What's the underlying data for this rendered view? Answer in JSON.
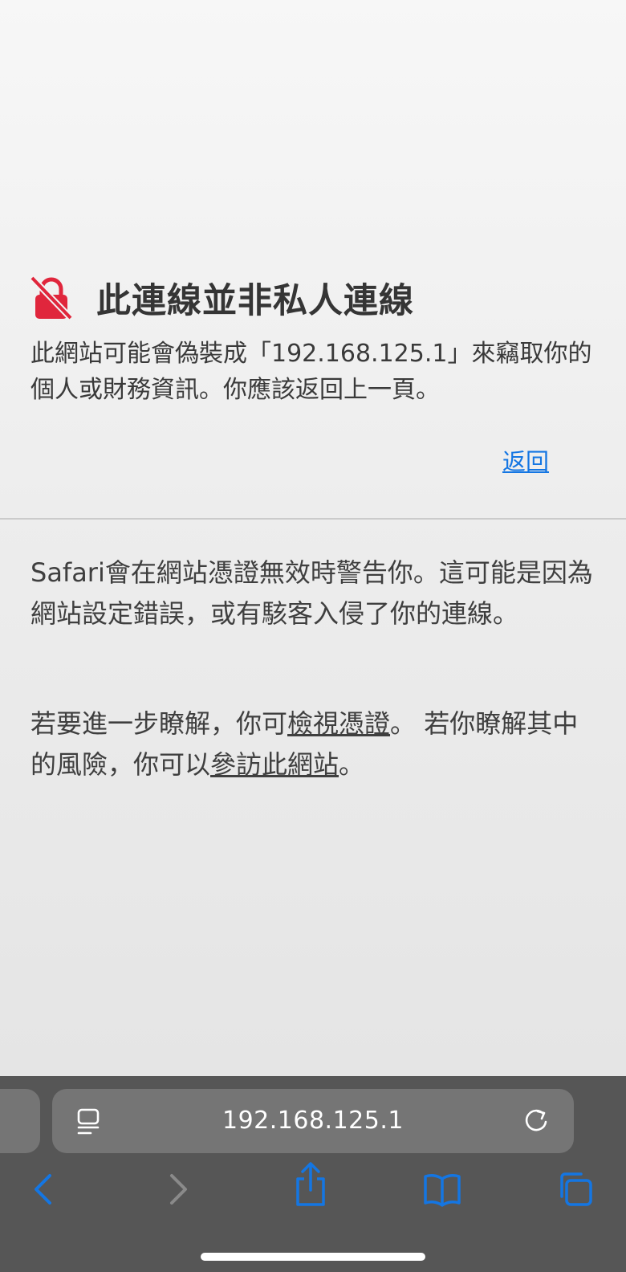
{
  "warning": {
    "title": "此連線並非私人連線",
    "body": "此網站可能會偽裝成「192.168.125.1」來竊取你的個人或財務資訊。你應該返回上一頁。",
    "back_link": "返回"
  },
  "info": {
    "paragraph": "Safari會在網站憑證無效時警告你。這可能是因為網站設定錯誤，或有駭客入侵了你的連線。",
    "more_prefix": "若要進一步瞭解，你可",
    "view_certificate_link": "檢視憑證",
    "more_middle": "。 若你瞭解其中的風險，你可以",
    "visit_site_link": "參訪此網站",
    "more_suffix": "。"
  },
  "address_bar": {
    "url": "192.168.125.1"
  },
  "icons": {
    "lock_icon": "lock-slash-icon",
    "reader_icon": "page-format-icon",
    "reload_icon": "reload-icon",
    "back_icon": "chevron-left-icon",
    "forward_icon": "chevron-right-icon",
    "share_icon": "share-icon",
    "bookmarks_icon": "book-icon",
    "tabs_icon": "tabs-icon"
  },
  "colors": {
    "accent": "#1476e3",
    "lock": "#e0263c",
    "toolbar": "#565656",
    "disabled": "#8a8a8a"
  }
}
